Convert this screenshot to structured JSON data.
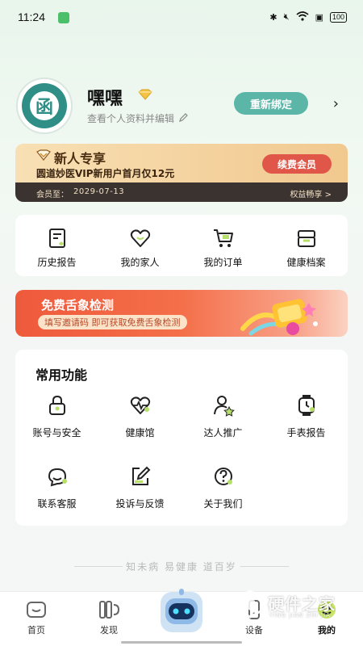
{
  "status_bar": {
    "time": "11:24",
    "battery": "100"
  },
  "profile": {
    "name": "嘿嘿",
    "edit_hint": "查看个人资料并编辑",
    "rebind_label": "重新绑定"
  },
  "member": {
    "title": "新人专享",
    "subtitle": "圆道妙医VIP新用户首月仅12元",
    "renew_label": "续费会员",
    "expiry_label": "会员至：",
    "expiry_date": "2029-07-13",
    "benefits_label": "权益畅享 >"
  },
  "quick_actions": [
    {
      "label": "历史报告",
      "icon": "report-icon"
    },
    {
      "label": "我的家人",
      "icon": "heart-icon"
    },
    {
      "label": "我的订单",
      "icon": "cart-icon"
    },
    {
      "label": "健康档案",
      "icon": "archive-icon"
    }
  ],
  "tongue_banner": {
    "title": "免费舌象检测",
    "subtitle": "填写邀请码 即可获取免费舌象检测"
  },
  "functions": {
    "title": "常用功能",
    "items": [
      {
        "label": "账号与安全",
        "icon": "lock-icon"
      },
      {
        "label": "健康馆",
        "icon": "heart-pulse-icon"
      },
      {
        "label": "达人推广",
        "icon": "user-star-icon"
      },
      {
        "label": "手表报告",
        "icon": "watch-icon"
      },
      {
        "label": "联系客服",
        "icon": "chat-icon"
      },
      {
        "label": "投诉与反馈",
        "icon": "edit-box-icon"
      },
      {
        "label": "关于我们",
        "icon": "question-icon"
      }
    ]
  },
  "slogan": "知未病 易健康 道百岁",
  "tabbar": {
    "items": [
      {
        "label": "首页",
        "icon": "home-icon",
        "active": false
      },
      {
        "label": "发现",
        "icon": "discover-icon",
        "active": false
      },
      {
        "label": "设备",
        "icon": "device-icon",
        "active": false
      },
      {
        "label": "我的",
        "icon": "profile-face-icon",
        "active": true
      }
    ]
  },
  "watermark": {
    "text": "硬件之家",
    "sub": "YING JIAN ZHI JIA"
  },
  "colors": {
    "accent_green": "#5cb6a8",
    "icon_dot_green": "#b6e06a",
    "renew_red": "#e0574a",
    "banner_orange": "#ee5a3c",
    "member_gold": "#f3cf9a"
  }
}
